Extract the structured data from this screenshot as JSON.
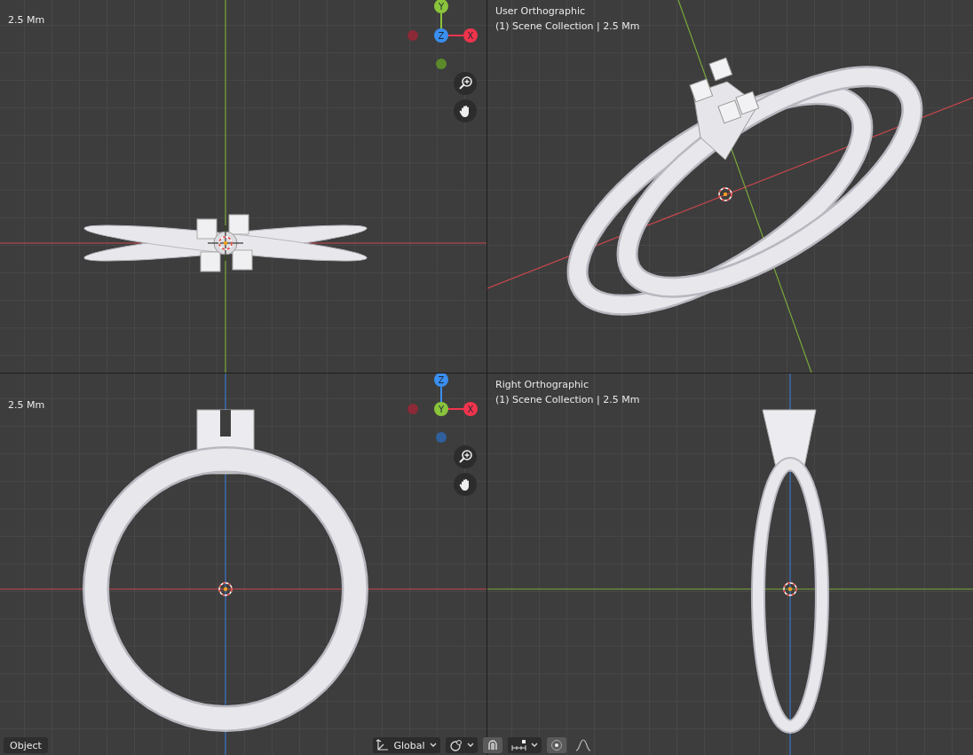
{
  "viewports": [
    {
      "kind": "top",
      "lines": [
        "2.5 Mm"
      ],
      "gizmo": [
        {
          "kind": "up",
          "label": "Y",
          "color": "#8ac43b"
        },
        {
          "kind": "center",
          "label": "Z",
          "color": "#3a8ff0"
        },
        {
          "kind": "right",
          "label": "X",
          "color": "#f0344c"
        },
        {
          "kind": "left",
          "color": "#8c2a37"
        },
        {
          "kind": "down",
          "color": "#5a8a2c"
        }
      ]
    },
    {
      "kind": "user",
      "lines": [
        "User Orthographic",
        "(1) Scene Collection | 2.5 Mm"
      ]
    },
    {
      "kind": "front",
      "lines": [
        "2.5 Mm"
      ],
      "gizmo": [
        {
          "kind": "up",
          "label": "Z",
          "color": "#3a8ff0"
        },
        {
          "kind": "center",
          "label": "Y",
          "color": "#8ac43b"
        },
        {
          "kind": "right",
          "label": "X",
          "color": "#f0344c"
        },
        {
          "kind": "left",
          "color": "#8c2a37"
        },
        {
          "kind": "down",
          "color": "#2f5f9c"
        }
      ]
    },
    {
      "kind": "right",
      "lines": [
        "Right Orthographic",
        "(1) Scene Collection | 2.5 Mm"
      ]
    }
  ],
  "toolbar": {
    "mode": "Object",
    "orientation": "Global",
    "snap": true,
    "proportional_editing": true
  }
}
